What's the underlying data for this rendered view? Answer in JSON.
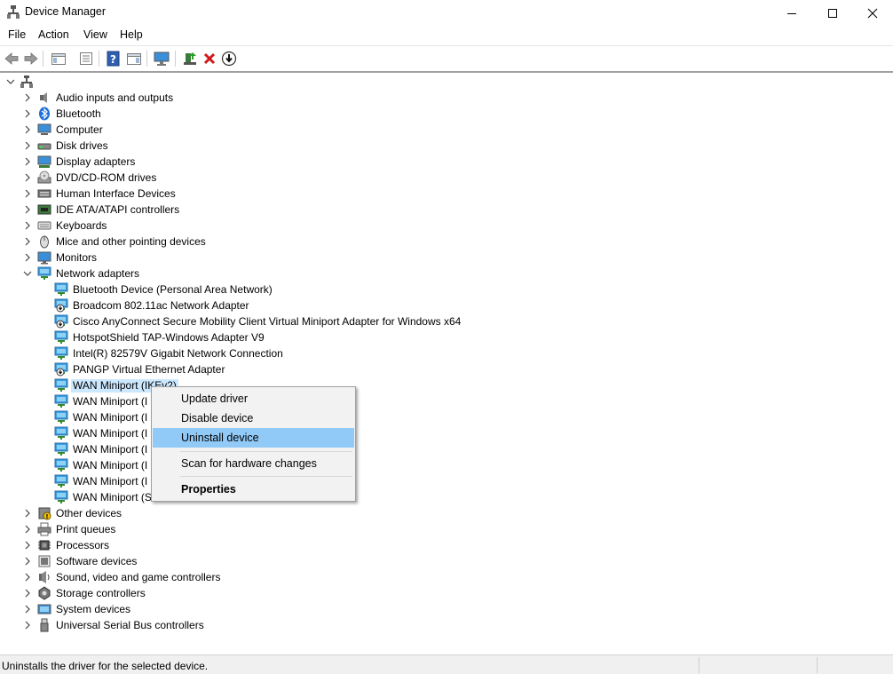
{
  "window": {
    "title": "Device Manager"
  },
  "menubar": {
    "items": [
      "File",
      "Action",
      "View",
      "Help"
    ]
  },
  "toolbar": {
    "buttons": [
      "back-icon",
      "forward-icon",
      "properties-pane-icon",
      "device-list-icon",
      "help-icon",
      "action-pane-icon",
      "monitor-icon",
      "update-driver-icon",
      "uninstall-icon",
      "download-driver-icon"
    ]
  },
  "tree": {
    "root_icon": "computer-icon",
    "categories": [
      {
        "label": "Audio inputs and outputs",
        "icon": "speaker-icon"
      },
      {
        "label": "Bluetooth",
        "icon": "bluetooth-icon"
      },
      {
        "label": "Computer",
        "icon": "computer-icon"
      },
      {
        "label": "Disk drives",
        "icon": "disk-drive-icon"
      },
      {
        "label": "Display adapters",
        "icon": "display-adapter-icon"
      },
      {
        "label": "DVD/CD-ROM drives",
        "icon": "dvd-icon"
      },
      {
        "label": "Human Interface Devices",
        "icon": "hid-icon"
      },
      {
        "label": "IDE ATA/ATAPI controllers",
        "icon": "ide-controller-icon"
      },
      {
        "label": "Keyboards",
        "icon": "keyboard-icon"
      },
      {
        "label": "Mice and other pointing devices",
        "icon": "mouse-icon"
      },
      {
        "label": "Monitors",
        "icon": "monitor-icon"
      },
      {
        "label": "Network adapters",
        "icon": "network-adapter-icon",
        "expanded": true
      }
    ],
    "network_children": [
      {
        "label": "Bluetooth Device (Personal Area Network)",
        "icon": "network-adapter-icon"
      },
      {
        "label": "Broadcom 802.11ac Network Adapter",
        "icon": "network-adapter-disabled-icon"
      },
      {
        "label": "Cisco AnyConnect Secure Mobility Client Virtual Miniport Adapter for Windows x64",
        "icon": "network-adapter-disabled-icon"
      },
      {
        "label": "HotspotShield TAP-Windows Adapter V9",
        "icon": "network-adapter-icon"
      },
      {
        "label": "Intel(R) 82579V Gigabit Network Connection",
        "icon": "network-adapter-icon"
      },
      {
        "label": "PANGP Virtual Ethernet Adapter",
        "icon": "network-adapter-disabled-icon"
      },
      {
        "label": "WAN Miniport (IKEv2)",
        "icon": "network-adapter-icon",
        "selected": true
      },
      {
        "label": "WAN Miniport (I",
        "icon": "network-adapter-icon"
      },
      {
        "label": "WAN Miniport (I",
        "icon": "network-adapter-icon"
      },
      {
        "label": "WAN Miniport (I",
        "icon": "network-adapter-icon"
      },
      {
        "label": "WAN Miniport (I",
        "icon": "network-adapter-icon"
      },
      {
        "label": "WAN Miniport (I",
        "icon": "network-adapter-icon"
      },
      {
        "label": "WAN Miniport (I",
        "icon": "network-adapter-icon"
      },
      {
        "label": "WAN Miniport (S",
        "icon": "network-adapter-icon"
      }
    ],
    "categories_after": [
      {
        "label": "Other devices",
        "icon": "other-devices-icon"
      },
      {
        "label": "Print queues",
        "icon": "printer-icon"
      },
      {
        "label": "Processors",
        "icon": "processor-icon"
      },
      {
        "label": "Software devices",
        "icon": "software-device-icon"
      },
      {
        "label": "Sound, video and game controllers",
        "icon": "sound-icon"
      },
      {
        "label": "Storage controllers",
        "icon": "storage-controller-icon"
      },
      {
        "label": "System devices",
        "icon": "system-device-icon"
      },
      {
        "label": "Universal Serial Bus controllers",
        "icon": "usb-icon"
      }
    ]
  },
  "context_menu": {
    "items": {
      "update_driver": "Update driver",
      "disable_device": "Disable device",
      "uninstall_device": "Uninstall device",
      "scan_hardware": "Scan for hardware changes",
      "properties": "Properties"
    },
    "highlighted": "Uninstall device"
  },
  "statusbar": {
    "message": "Uninstalls the driver for the selected device."
  },
  "colors": {
    "selection": "#cce8ff",
    "menu_highlight": "#91c9f7",
    "icon_blue": "#2b7bd3"
  }
}
